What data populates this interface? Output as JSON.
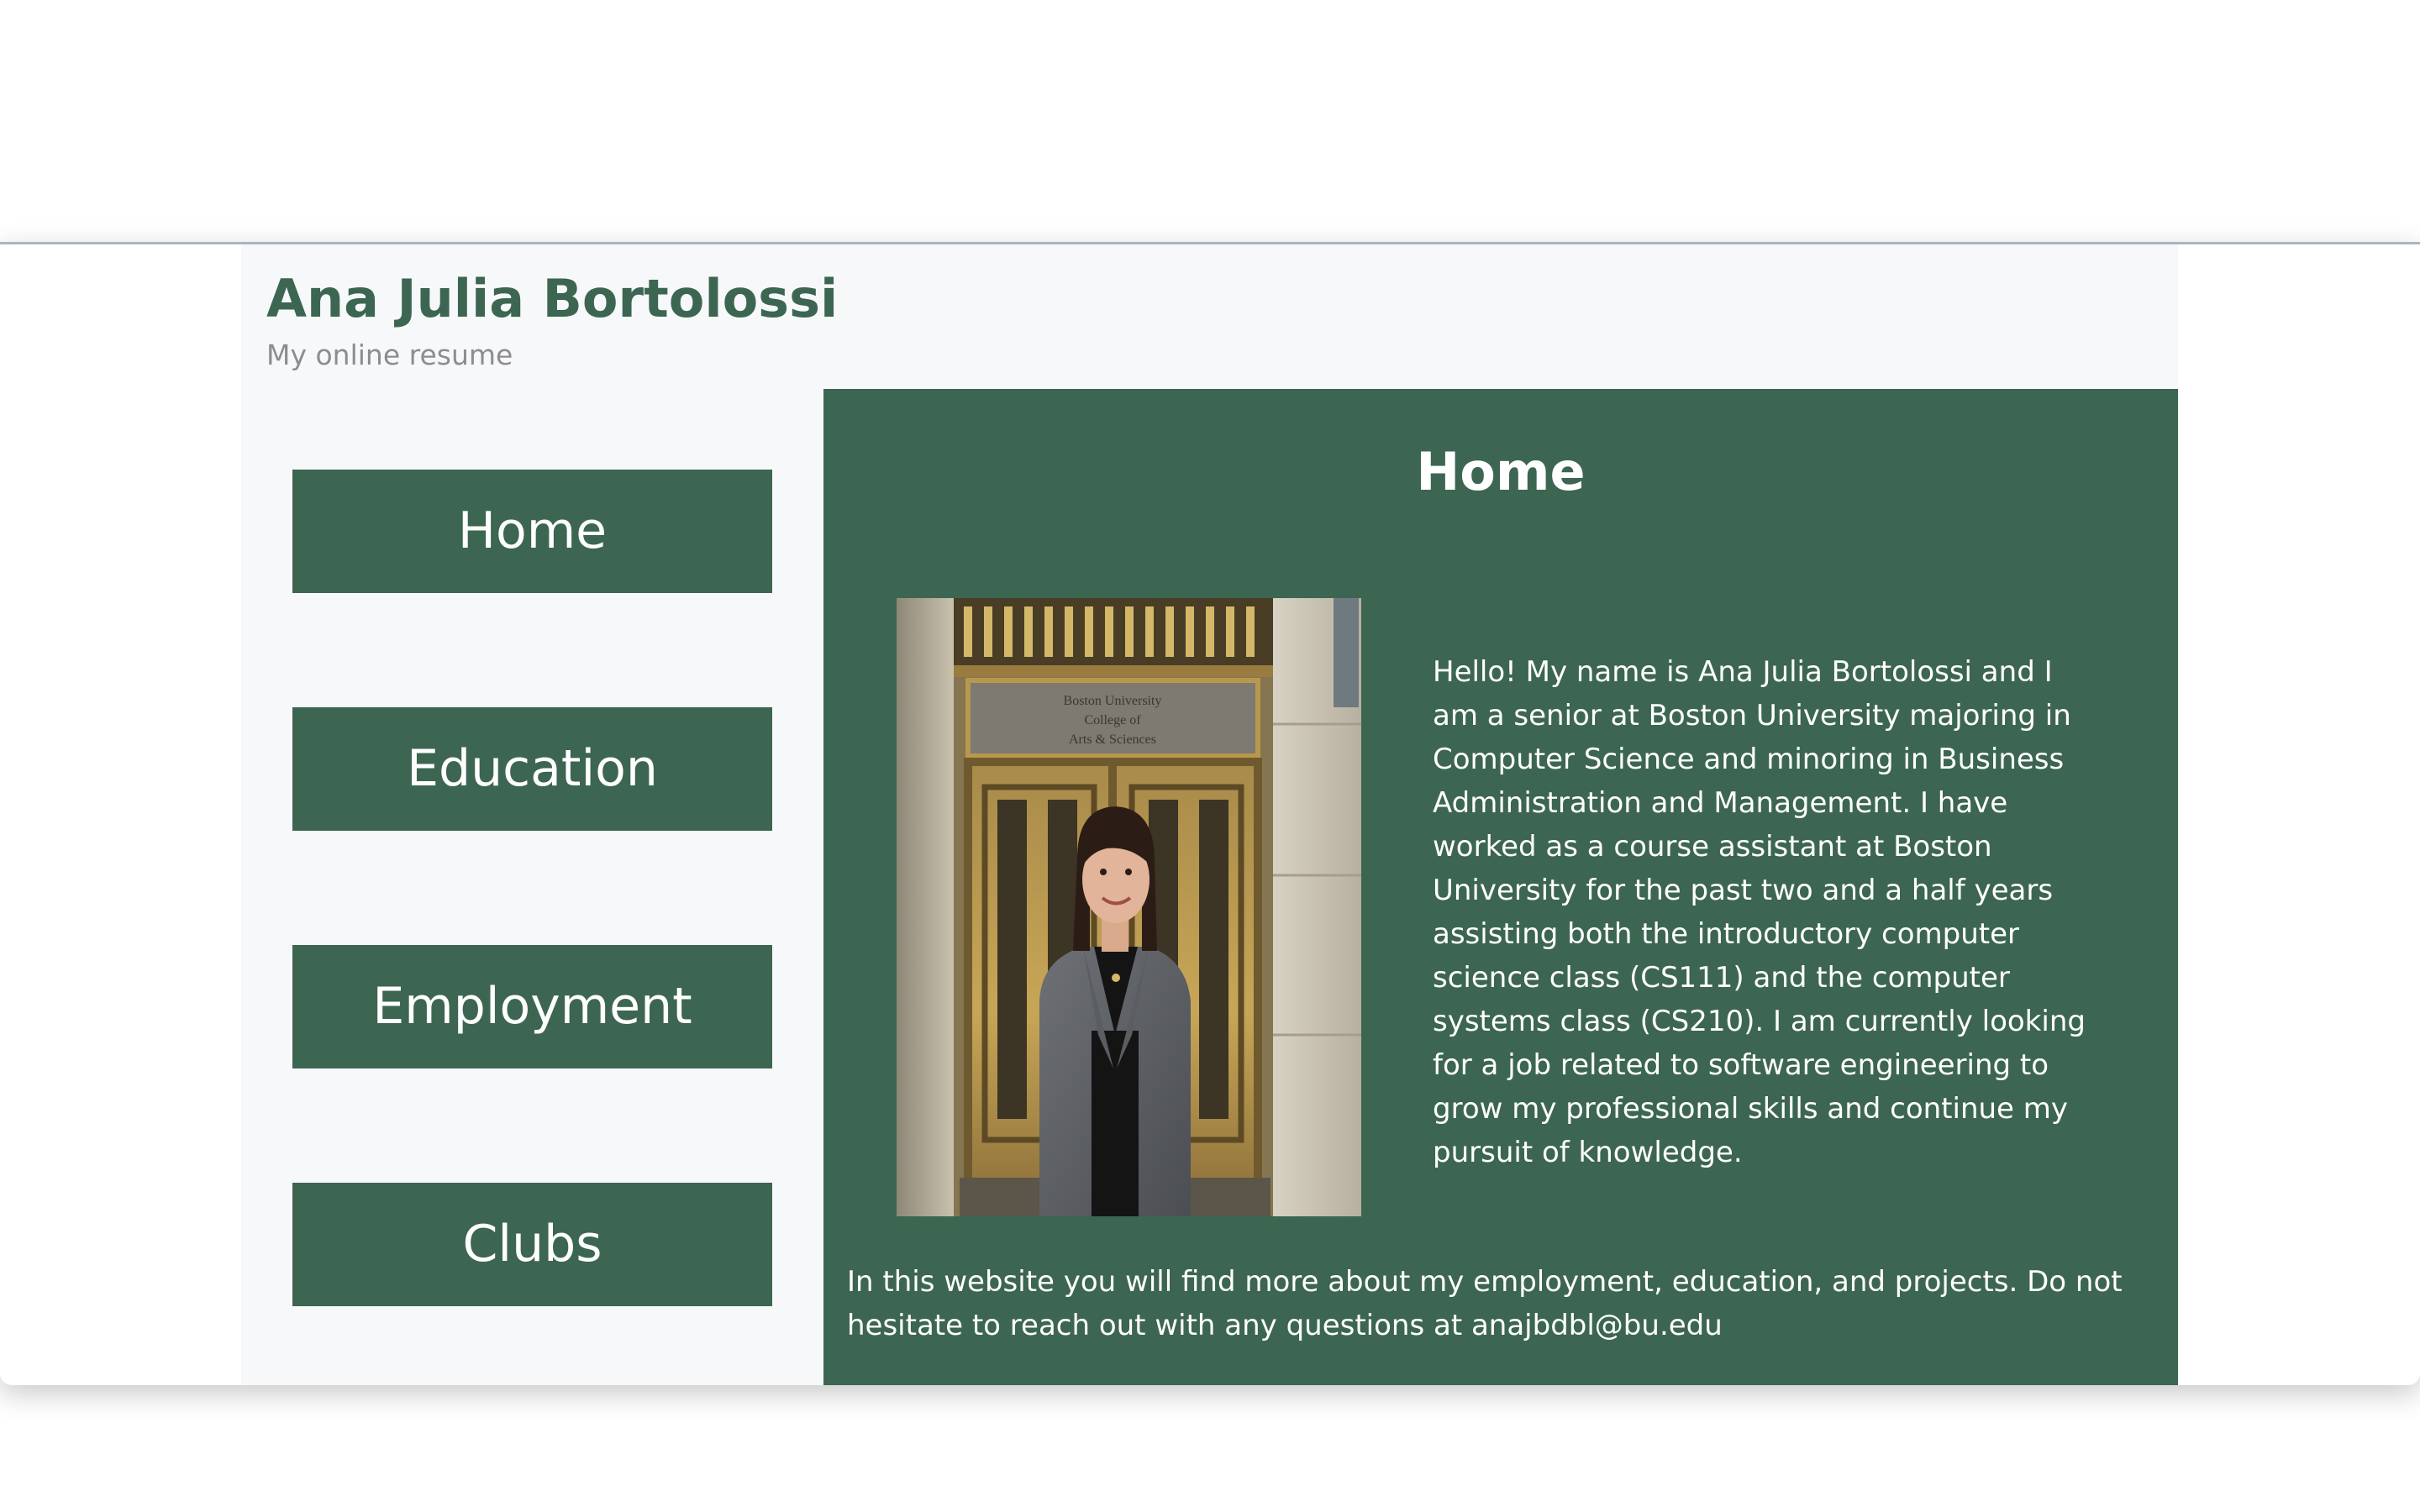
{
  "header": {
    "title": "Ana Julia Bortolossi",
    "subtitle": "My online resume"
  },
  "nav": {
    "items": [
      {
        "label": "Home"
      },
      {
        "label": "Education"
      },
      {
        "label": "Employment"
      },
      {
        "label": "Clubs"
      }
    ]
  },
  "main": {
    "heading": "Home",
    "photo": {
      "sign_line1": "Boston University",
      "sign_line2": "College of",
      "sign_line3": "Arts & Sciences"
    },
    "intro": "Hello! My name is Ana Julia Bortolossi and I am a senior at Boston University majoring in Computer Science and minoring in Business Administration and Management. I have worked as a course assistant at Boston University for the past two and a half years assisting both the introductory computer science class (CS111) and the computer systems class (CS210). I am currently looking for a job related to software engineering to grow my professional skills and continue my pursuit of knowledge.",
    "footer_text": "In this website you will find more about my employment, education, and projects. Do not hesitate to reach out with any questions at anajbdbl@bu.edu"
  },
  "colors": {
    "brand_green": "#3c6651",
    "page_background": "#f7f8fa",
    "subtitle_gray": "#8d8d8d"
  }
}
